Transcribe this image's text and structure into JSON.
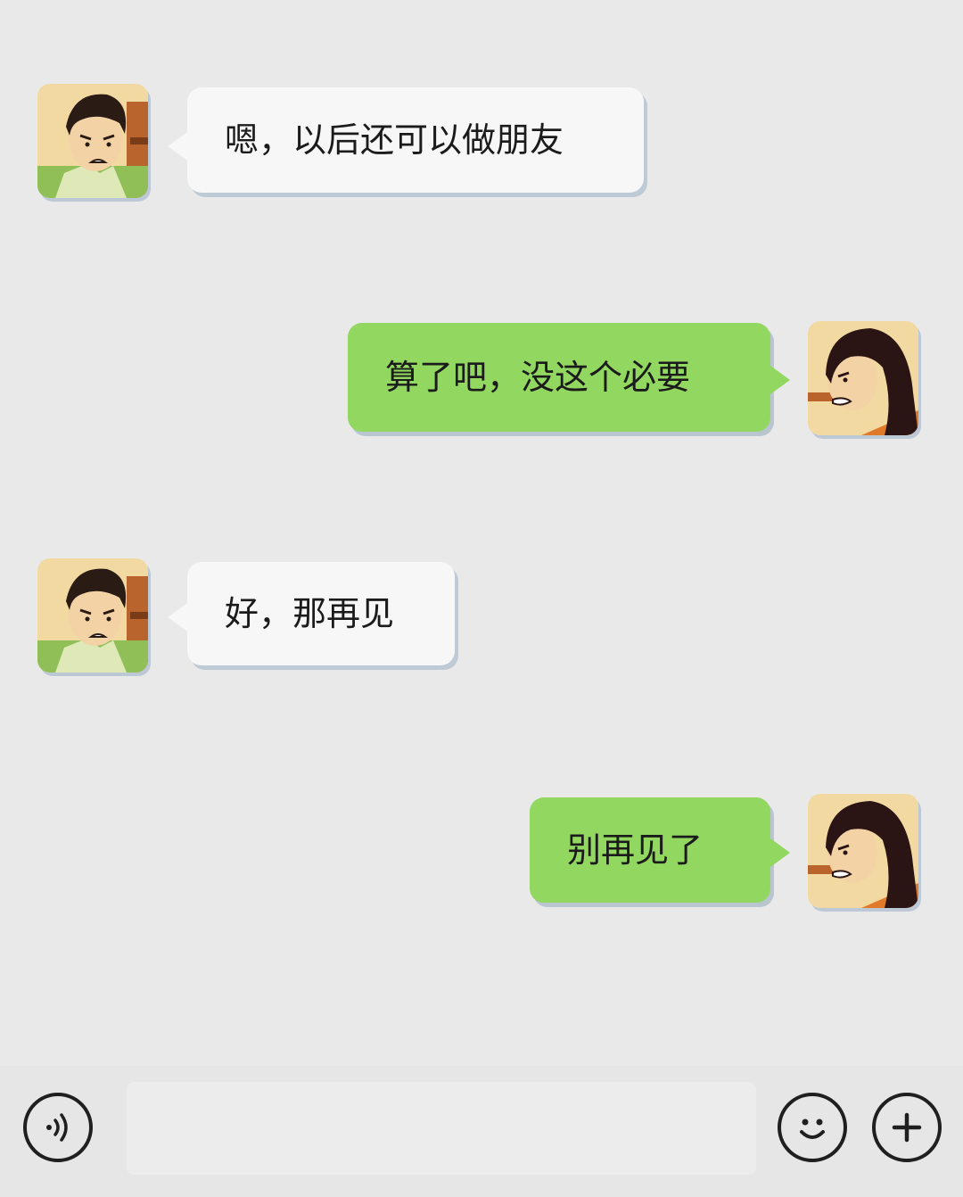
{
  "messages": [
    {
      "side": "left",
      "avatar_icon": "man-avatar-icon",
      "text": "嗯，以后还可以做朋友"
    },
    {
      "side": "right",
      "avatar_icon": "woman-avatar-icon",
      "text": "算了吧，没这个必要"
    },
    {
      "side": "left",
      "avatar_icon": "man-avatar-icon",
      "text": "好，那再见"
    },
    {
      "side": "right",
      "avatar_icon": "woman-avatar-icon",
      "text": "别再见了"
    }
  ],
  "input_bar": {
    "voice_icon": "voice-icon",
    "input_value": "",
    "emoji_icon": "smiley-icon",
    "plus_icon": "plus-icon"
  },
  "colors": {
    "background": "#e9e9e9",
    "incoming_bubble": "#f7f7f7",
    "outgoing_bubble": "#91d760"
  }
}
